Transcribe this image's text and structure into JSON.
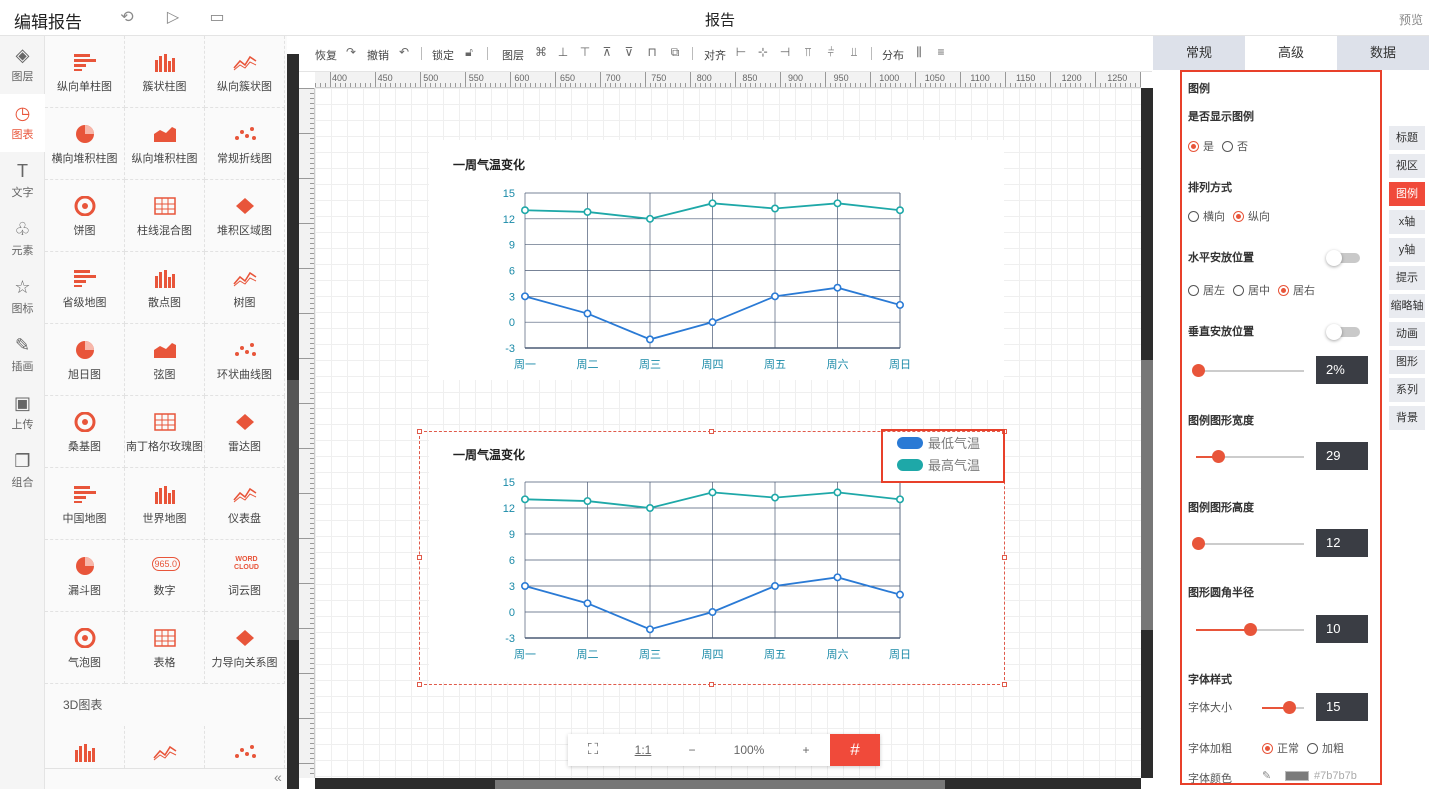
{
  "app": {
    "title": "编辑报告",
    "page_title": "报告",
    "preview": "预览"
  },
  "left_rail": [
    {
      "label": "图层",
      "icon": "layers-icon",
      "glyph": "◈"
    },
    {
      "label": "图表",
      "icon": "chart-clock-icon",
      "glyph": "◷"
    },
    {
      "label": "文字",
      "icon": "text-icon",
      "glyph": "T"
    },
    {
      "label": "元素",
      "icon": "shapes-icon",
      "glyph": "♧"
    },
    {
      "label": "图标",
      "icon": "star-icon",
      "glyph": "☆"
    },
    {
      "label": "插画",
      "icon": "palette-icon",
      "glyph": "✎"
    },
    {
      "label": "上传",
      "icon": "image-upload-icon",
      "glyph": "▣"
    },
    {
      "label": "组合",
      "icon": "group-icon",
      "glyph": "❐"
    }
  ],
  "palette": {
    "items": [
      "纵向单柱图",
      "簇状柱图",
      "纵向簇状图",
      "横向堆积柱图",
      "纵向堆积柱图",
      "常规折线图",
      "饼图",
      "柱线混合图",
      "堆积区域图",
      "省级地图",
      "散点图",
      "树图",
      "旭日图",
      "弦图",
      "环状曲线图",
      "桑基图",
      "南丁格尔玫瑰图",
      "雷达图",
      "中国地图",
      "世界地图",
      "仪表盘",
      "漏斗图",
      "数字",
      "词云图",
      "气泡图",
      "表格",
      "力导向关系图"
    ],
    "section_3d": "3D图表",
    "number_icon_text": "965.0",
    "wordcloud_icon_text": "WORD CLOUD"
  },
  "toolbar": {
    "redo": "恢复",
    "undo": "撤销",
    "lock": "锁定",
    "layer": "图层",
    "align": "对齐",
    "distribute": "分布"
  },
  "ruler": {
    "h_labels": [
      "400",
      "450",
      "500",
      "550",
      "600",
      "650",
      "700",
      "750",
      "800",
      "850",
      "900",
      "950",
      "1000",
      "1050",
      "1100",
      "1150",
      "1200",
      "1250"
    ]
  },
  "colors": {
    "accent": "#e8553a",
    "min_series": "#2a7ad5",
    "max_series": "#1ea8a8",
    "grid": "#4a5a75"
  },
  "chart_data": [
    {
      "type": "line",
      "title": "一周气温变化",
      "categories": [
        "周一",
        "周二",
        "周三",
        "周四",
        "周五",
        "周六",
        "周日"
      ],
      "series": [
        {
          "values": [
            13,
            12.8,
            12,
            13.8,
            13.2,
            13.8,
            13
          ]
        },
        {
          "values": [
            3,
            1,
            -2,
            0,
            3,
            4,
            2
          ]
        }
      ],
      "yticks": [
        15,
        12,
        9,
        6,
        3,
        0,
        -3
      ],
      "ylim": [
        -3,
        15
      ],
      "legend": "none"
    },
    {
      "type": "line",
      "title": "一周气温变化",
      "categories": [
        "周一",
        "周二",
        "周三",
        "周四",
        "周五",
        "周六",
        "周日"
      ],
      "series": [
        {
          "name": "最低气温",
          "values": [
            3,
            1,
            -2,
            0,
            3,
            4,
            2
          ]
        },
        {
          "name": "最高气温",
          "values": [
            13,
            12.8,
            12,
            13.8,
            13.2,
            13.8,
            13
          ]
        }
      ],
      "yticks": [
        15,
        12,
        9,
        6,
        3,
        0,
        -3
      ],
      "ylim": [
        -3,
        15
      ],
      "legend": "top-right, vertical"
    }
  ],
  "zoom": {
    "fit": "fit-screen",
    "one_to_one": "1:1",
    "minus": "−",
    "level": "100%",
    "plus": "+"
  },
  "panel": {
    "tabs": [
      "常规",
      "高级",
      "数据"
    ],
    "active_tab": "高级",
    "section": "图例",
    "show_legend": {
      "label": "是否显示图例",
      "options": [
        "是",
        "否"
      ],
      "selected": "是"
    },
    "orient": {
      "label": "排列方式",
      "options": [
        "横向",
        "纵向"
      ],
      "selected": "纵向"
    },
    "h_pos": {
      "label": "水平安放位置",
      "options": [
        "居左",
        "居中",
        "居右"
      ],
      "selected": "居右"
    },
    "v_pos": {
      "label": "垂直安放位置",
      "value": "2%",
      "fraction": 0.02
    },
    "item_width": {
      "label": "图例图形宽度",
      "value": "29",
      "fraction": 0.2
    },
    "item_height": {
      "label": "图例图形高度",
      "value": "12",
      "fraction": 0.02
    },
    "radius": {
      "label": "图形圆角半径",
      "value": "10",
      "fraction": 0.5
    },
    "font": {
      "label": "字体样式",
      "size_label": "字体大小",
      "size_value": "15",
      "size_fraction": 0.65,
      "weight_label": "字体加粗",
      "weight_options": [
        "正常",
        "加粗"
      ],
      "weight_selected": "正常",
      "color_label": "字体颜色",
      "color_value": "#7b7b7b"
    }
  },
  "side_tabs": [
    "标题",
    "视区",
    "图例",
    "x轴",
    "y轴",
    "提示",
    "缩略轴",
    "动画",
    "图形",
    "系列",
    "背景"
  ],
  "active_side_tab": "图例"
}
